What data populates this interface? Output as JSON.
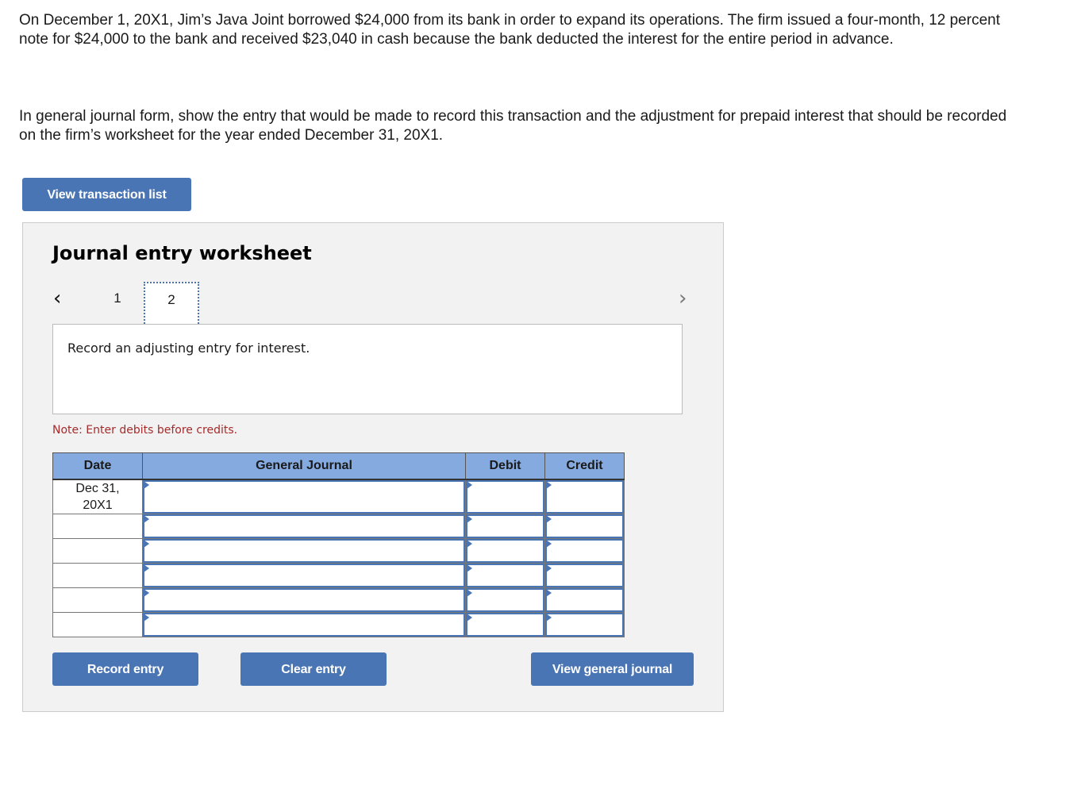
{
  "problem": {
    "paragraph1": "On December 1, 20X1, Jim’s Java Joint borrowed $24,000 from its bank in order to expand its operations. The firm issued a four-month, 12 percent note for $24,000 to the bank and received $23,040 in cash because the bank deducted the interest for the entire period in advance.",
    "paragraph2": "In general journal form, show the entry that would be made to record this transaction and the adjustment for prepaid interest that should be recorded on the firm’s worksheet for the year ended December 31, 20X1."
  },
  "buttons": {
    "view_transaction_list": "View transaction list",
    "record_entry": "Record entry",
    "clear_entry": "Clear entry",
    "view_general_journal": "View general journal"
  },
  "worksheet": {
    "title": "Journal entry worksheet",
    "nav": {
      "prev_icon": "chevron-left-icon",
      "next_icon": "chevron-right-icon",
      "prev_glyph": "‹",
      "next_glyph": "›"
    },
    "tabs": [
      {
        "label": "1",
        "active": false
      },
      {
        "label": "2",
        "active": true
      }
    ],
    "instruction": "Record an adjusting entry for interest.",
    "note": "Note: Enter debits before credits.",
    "table": {
      "headers": [
        "Date",
        "General Journal",
        "Debit",
        "Credit"
      ],
      "rows": [
        {
          "date": "Dec 31, 20X1",
          "account": "",
          "debit": "",
          "credit": ""
        },
        {
          "date": "",
          "account": "",
          "debit": "",
          "credit": ""
        },
        {
          "date": "",
          "account": "",
          "debit": "",
          "credit": ""
        },
        {
          "date": "",
          "account": "",
          "debit": "",
          "credit": ""
        },
        {
          "date": "",
          "account": "",
          "debit": "",
          "credit": ""
        },
        {
          "date": "",
          "account": "",
          "debit": "",
          "credit": ""
        }
      ]
    }
  },
  "colors": {
    "accent": "#4a75b5",
    "header_bg": "#84aadf",
    "note": "#a52a2a",
    "panel_bg": "#f2f2f2"
  }
}
